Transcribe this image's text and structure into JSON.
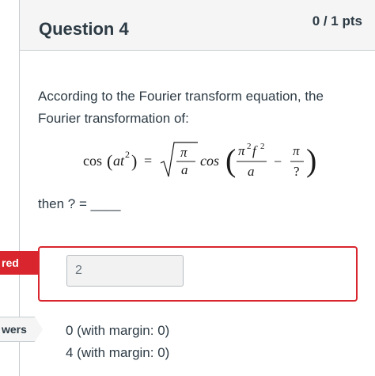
{
  "question": {
    "title": "Question 4",
    "points": "0 / 1 pts",
    "text": "According to the Fourier transform equation, the Fourier transformation of:",
    "equation": {
      "lhs_func": "cos",
      "lhs_arg_var": "at",
      "lhs_arg_exp": "2",
      "equals": "=",
      "sqrt_num": "π",
      "sqrt_den": "a",
      "rhs_func": "cos",
      "frac1_num_base": "π",
      "frac1_num_exp1": "2",
      "frac1_num_var": "f",
      "frac1_num_exp2": "2",
      "frac1_den": "a",
      "minus": "−",
      "frac2_num": "π",
      "frac2_den": "?"
    },
    "prompt": "then ? = ____"
  },
  "flags": {
    "answered": "red",
    "answers": "wers"
  },
  "answer": {
    "value": "2"
  },
  "correct_answers": [
    "0 (with margin: 0)",
    "4 (with margin: 0)"
  ],
  "colors": {
    "incorrect": "#d9252d",
    "header_bg": "#f5f5f5",
    "text": "#2d3b45"
  }
}
